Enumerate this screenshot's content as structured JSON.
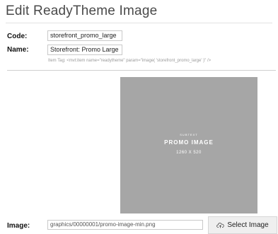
{
  "page": {
    "title": "Edit ReadyTheme Image"
  },
  "form": {
    "code_label": "Code:",
    "code_value": "storefront_promo_large",
    "name_label": "Name:",
    "name_value": "Storefront: Promo Large",
    "item_tag_hint": "Item Tag: <mvt:item name=\"readytheme\" param=\"image( 'storefront_promo_large' )\" />",
    "image_label": "Image:",
    "image_path": "graphics/00000001/promo-image-min.png",
    "select_button_label": "Select Image",
    "select_button_icon": "cloud-upload-icon"
  },
  "preview": {
    "subtext": "SUBTEXT",
    "main": "PROMO IMAGE",
    "size": "1260 X 520",
    "background": "#a6a6a6"
  }
}
